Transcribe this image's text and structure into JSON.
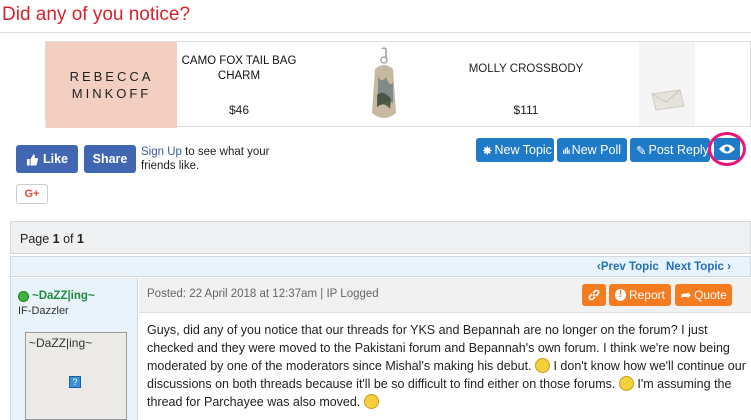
{
  "thread_title": "Did any of you notice?",
  "ad": {
    "brand_line1": "REBECCA",
    "brand_line2": "MINKOFF",
    "product1_name_line1": "CAMO FOX TAIL BAG",
    "product1_name_line2": "CHARM",
    "product1_price": "$46",
    "product2_name": "MOLLY CROSSBODY",
    "product2_price": "$111"
  },
  "social": {
    "like_label": "Like",
    "share_label": "Share",
    "signup_link": "Sign Up",
    "signup_text": " to see what your",
    "signup_text2": "friends like.",
    "gplus_label": "G+"
  },
  "toolbar": {
    "new_topic": "New Topic",
    "new_poll": "New Poll",
    "post_reply": "Post Reply"
  },
  "pagination": {
    "prefix": "Page ",
    "current": "1",
    "of": " of ",
    "total": "1"
  },
  "nav": {
    "prev_topic": "Prev Topic",
    "next_topic": "Next Topic"
  },
  "post": {
    "author_name": "~DaZZ|ing~",
    "author_rank": "IF-Dazzler",
    "avatar_name": "~DaZZ|ing~",
    "posted_meta": "Posted: 22 April 2018 at 12:37am | IP Logged",
    "report_label": "Report",
    "quote_label": "Quote",
    "body_part1": "Guys, did any of you notice that our threads for YKS and Bepannah are no longer on the forum?  I just checked and they were moved to the Pakistani forum and Bepannah's own forum.  I think we're now being moderated by one of the moderators since Mishal's making his debut. ",
    "body_part2": "  I don't know how we'll continue our discussions on both threads because it'll be so difficult to find either on those forums. ",
    "body_part3": " I'm assuming the thread for Parchayee was also moved. "
  },
  "colors": {
    "title_red": "#d5232b",
    "facebook_blue": "#4267b2",
    "toolbar_blue": "#1f7ac8",
    "action_orange": "#f47b20",
    "highlight_pink": "#e8157a"
  }
}
